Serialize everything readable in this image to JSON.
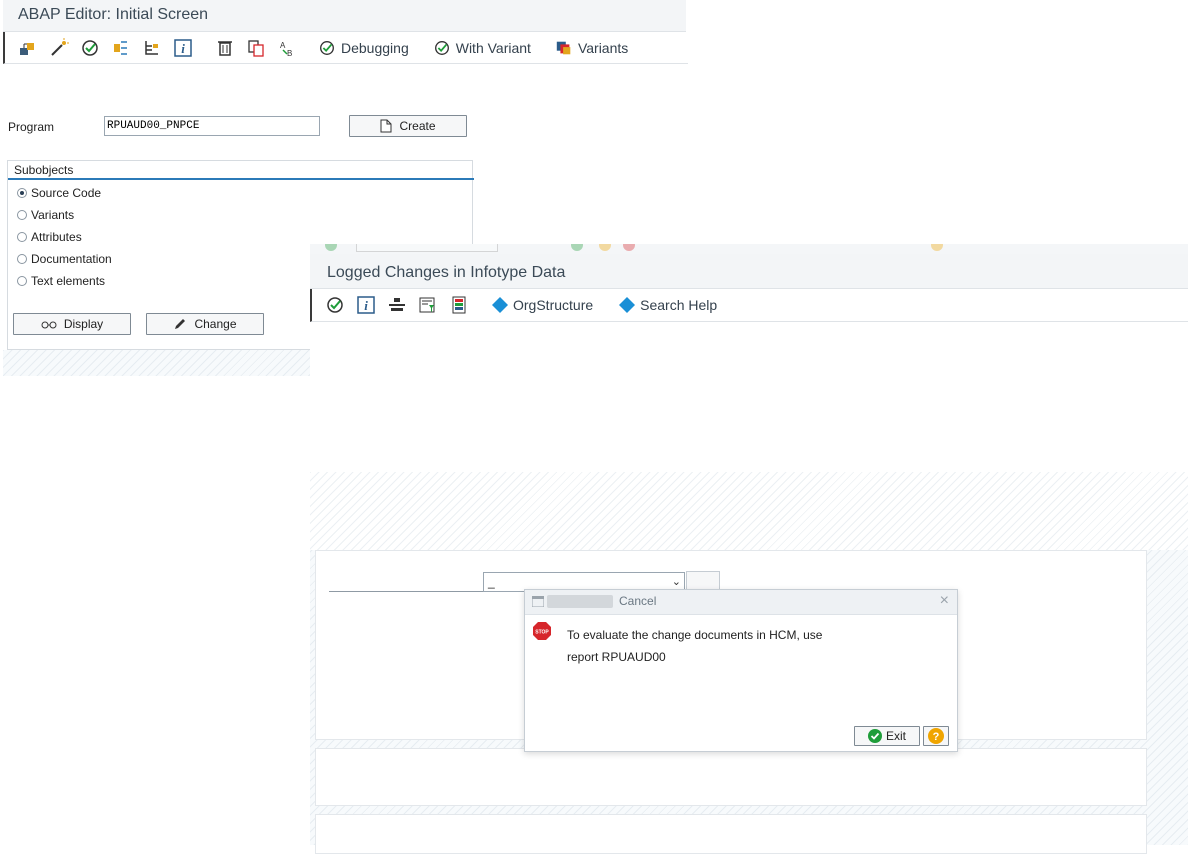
{
  "editor": {
    "title": "ABAP Editor: Initial Screen",
    "toolbar": {
      "icons": [
        "object-list-icon",
        "magic-wand-icon",
        "execute-icon",
        "where-used-icon",
        "hierarchy-icon",
        "info-icon",
        "delete-icon",
        "copy-icon",
        "rename-icon"
      ],
      "debugging_label": "Debugging",
      "with_variant_label": "With Variant",
      "variants_label": "Variants"
    },
    "program_label": "Program",
    "program_value": "RPUAUD00_PNPCE",
    "create_label": "Create",
    "subobjects": {
      "title": "Subobjects",
      "options": [
        {
          "label": "Source Code",
          "selected": true
        },
        {
          "label": "Variants",
          "selected": false
        },
        {
          "label": "Attributes",
          "selected": false
        },
        {
          "label": "Documentation",
          "selected": false
        },
        {
          "label": "Text elements",
          "selected": false
        }
      ]
    },
    "display_label": "Display",
    "change_label": "Change"
  },
  "report": {
    "title": "Logged Changes in Infotype Data",
    "toolbar": {
      "icons": [
        "execute-icon",
        "info-icon",
        "align-icon",
        "filter-icon",
        "layout-icon"
      ],
      "orgstructure_label": "OrgStructure",
      "search_help_label": "Search Help"
    },
    "dropdown_value": "_"
  },
  "dialog": {
    "title": "Cancel",
    "message_line1": "To evaluate the change documents in HCM, use",
    "message_line2": "report RPUAUD00",
    "exit_label": "Exit"
  },
  "colors": {
    "accent_blue": "#2b7ab8",
    "diamond_blue": "#1a8fd6",
    "ok_green": "#1f9d3a",
    "stop_red": "#d6262b",
    "help_orange": "#f0a500"
  }
}
